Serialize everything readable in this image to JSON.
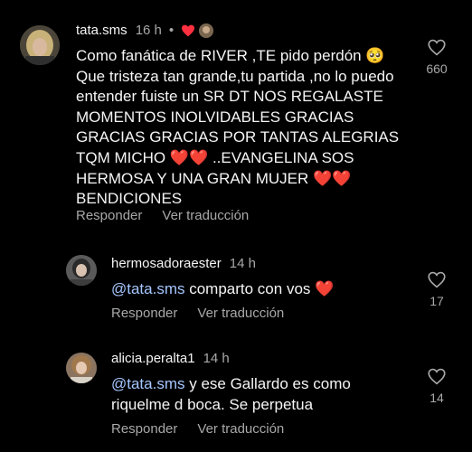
{
  "colors": {
    "background": "#000000",
    "text": "#f5f5f5",
    "secondary": "#a8a8a8",
    "mention": "#a5c7ff",
    "heart_red": "#ff3040"
  },
  "comments": [
    {
      "username": "tata.sms",
      "time": "16 h",
      "dot": "•",
      "text_parts": [
        "Como fanática de RIVER ,TE pido perdón 🥺 Que tristeza tan grande,tu partida ,no lo puedo entender fuiste un SR DT NOS REGALASTE MOMENTOS INOLVIDABLES GRACIAS GRACIAS GRACIAS POR TANTAS ALEGRIAS TQM MICHO ",
        "❤️❤️",
        " ..EVANGELINA SOS HERMOSA Y UNA GRAN MUJER ",
        "❤️❤️",
        " BENDICIONES"
      ],
      "reply_label": "Responder",
      "translate_label": "Ver traducción",
      "likes": "660",
      "like_icon": "heart-outline-icon"
    },
    {
      "username": "hermosadoraester",
      "time": "14 h",
      "mention": "@tata.sms",
      "text": " comparto con vos ",
      "trailing_emoji": "❤️",
      "reply_label": "Responder",
      "translate_label": "Ver traducción",
      "likes": "17",
      "like_icon": "heart-outline-icon"
    },
    {
      "username": "alicia.peralta1",
      "time": "14 h",
      "mention": "@tata.sms",
      "text": " y ese Gallardo es como riquelme d boca. Se perpetua",
      "reply_label": "Responder",
      "translate_label": "Ver traducción",
      "likes": "14",
      "like_icon": "heart-outline-icon"
    }
  ]
}
